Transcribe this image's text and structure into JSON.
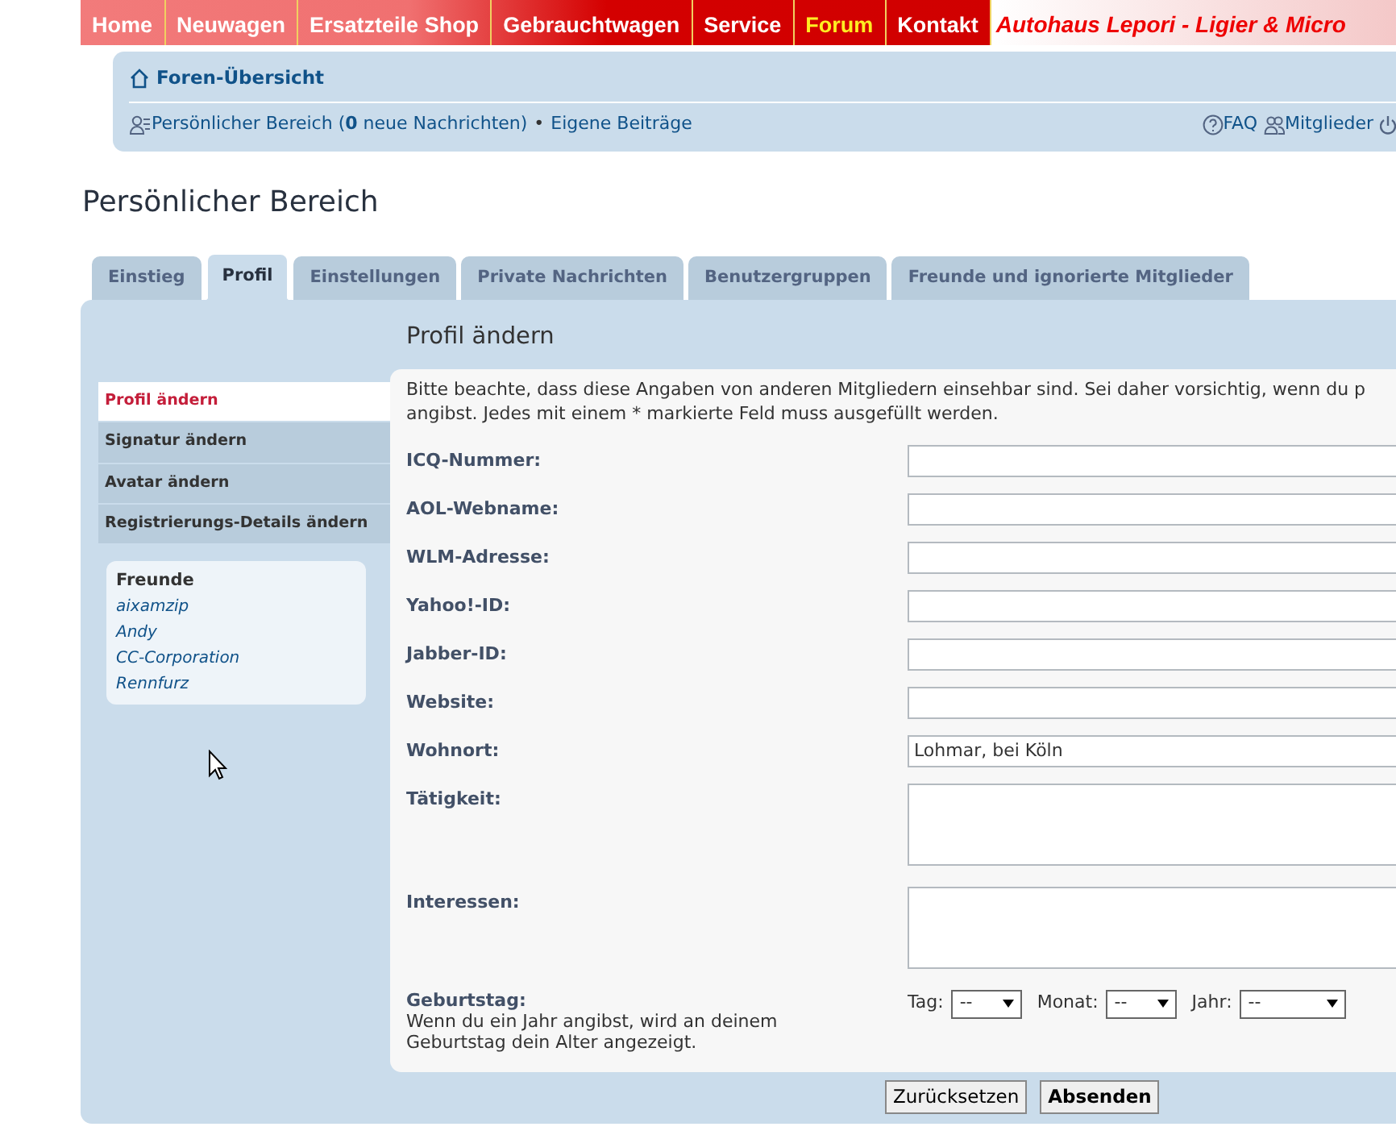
{
  "top_nav": {
    "items": [
      {
        "label": "Home",
        "selected": false
      },
      {
        "label": "Neuwagen",
        "selected": false
      },
      {
        "label": "Ersatzteile Shop",
        "selected": false
      },
      {
        "label": "Gebrauchtwagen",
        "selected": false
      },
      {
        "label": "Service",
        "selected": false
      },
      {
        "label": "Forum",
        "selected": true
      },
      {
        "label": "Kontakt",
        "selected": false
      }
    ],
    "banner": "Autohaus Lepori - Ligier & Micro"
  },
  "header": {
    "breadcrumb": "Foren-Übersicht",
    "user_link": "Persönlicher Bereich (**0** neue Nachrichten)",
    "separator": "•",
    "own_posts": "Eigene Beiträge",
    "right_links": [
      "FAQ",
      "Mitglieder"
    ]
  },
  "page_title": "Persönlicher Bereich",
  "tabs": [
    {
      "label": "Einstieg",
      "selected": false
    },
    {
      "label": "Profil",
      "selected": true
    },
    {
      "label": "Einstellungen",
      "selected": false
    },
    {
      "label": "Private Nachrichten",
      "selected": false
    },
    {
      "label": "Benutzergruppen",
      "selected": false
    },
    {
      "label": "Freunde und ignorierte Mitglieder",
      "selected": false
    }
  ],
  "sidebar": {
    "items": [
      {
        "label": "Profil ändern",
        "selected": true
      },
      {
        "label": "Signatur ändern",
        "selected": false
      },
      {
        "label": "Avatar ändern",
        "selected": false
      },
      {
        "label": "Registrierungs-Details ändern",
        "selected": false
      }
    ],
    "friends": {
      "title": "Freunde",
      "names": [
        "aixamzip",
        "Andy",
        "CC-Corporation",
        "Rennfurz"
      ]
    }
  },
  "form": {
    "title": "Profil ändern",
    "intro_lines": [
      "Bitte beachte, dass diese Angaben von anderen Mitgliedern einsehbar sind. Sei daher vorsichtig, wenn du p",
      "angibst. Jedes mit einem * markierte Feld muss ausgefüllt werden."
    ],
    "fields": [
      {
        "label": "ICQ-Nummer:",
        "kind": "text"
      },
      {
        "label": "AOL-Webname:",
        "kind": "text"
      },
      {
        "label": "WLM-Adresse:",
        "kind": "text"
      },
      {
        "label": "Yahoo!-ID:",
        "kind": "text"
      },
      {
        "label": "Jabber-ID:",
        "kind": "text"
      },
      {
        "label": "Website:",
        "kind": "text"
      },
      {
        "label": "Wohnort:",
        "kind": "text",
        "value": "Lohmar, bei Köln"
      },
      {
        "label": "Tätigkeit:",
        "kind": "textarea"
      },
      {
        "label": "Interessen:",
        "kind": "textarea"
      }
    ],
    "birthday": {
      "label": "Geburtstag:",
      "hint": "Wenn du ein Jahr angibst, wird an deinem Geburtstag dein Alter angezeigt.",
      "selects": [
        {
          "label": "Tag:",
          "value": "--"
        },
        {
          "label": "Monat:",
          "value": "--"
        },
        {
          "label": "Jahr:",
          "value": "--"
        }
      ]
    },
    "buttons": [
      {
        "label": "Zurücksetzen",
        "kind": "reset"
      },
      {
        "label": "Absenden",
        "kind": "submit"
      }
    ]
  }
}
